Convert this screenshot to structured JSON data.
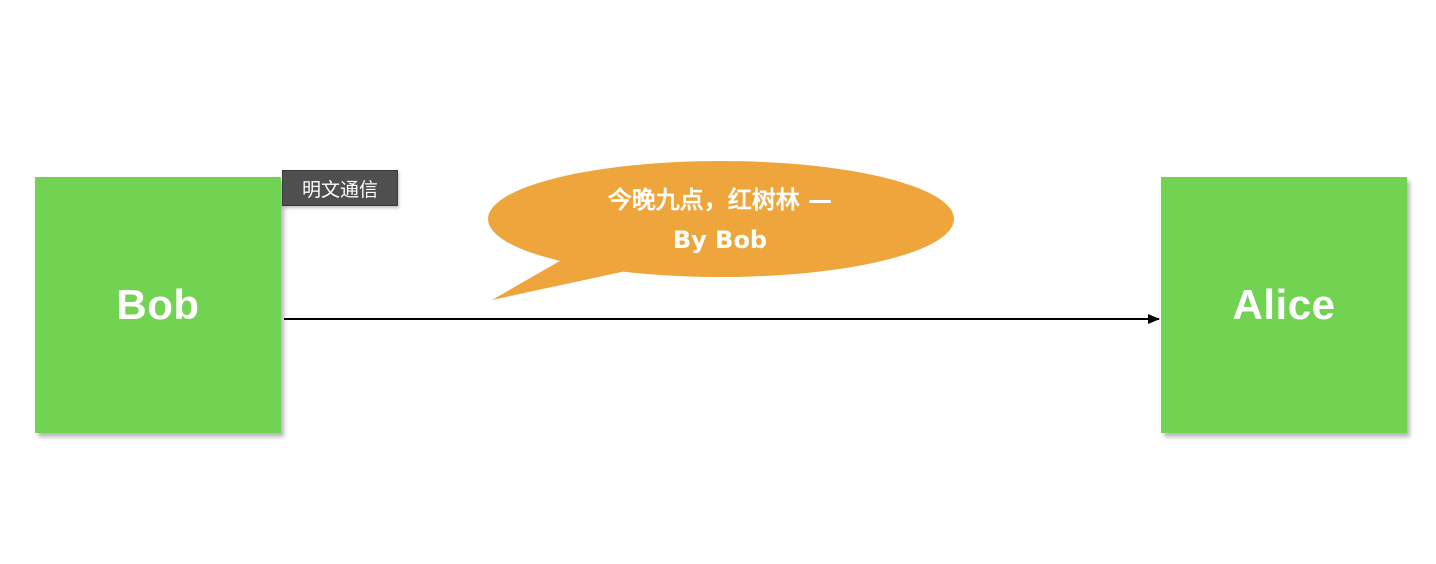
{
  "nodes": {
    "sender": "Bob",
    "receiver": "Alice"
  },
  "tag_label": "明文通信",
  "message": {
    "line1": "今晚九点，红树林 —",
    "line2": "By Bob"
  },
  "colors": {
    "node": "#72d353",
    "bubble": "#eea53c",
    "tag": "#4f4f4f",
    "arrow": "#000000"
  }
}
